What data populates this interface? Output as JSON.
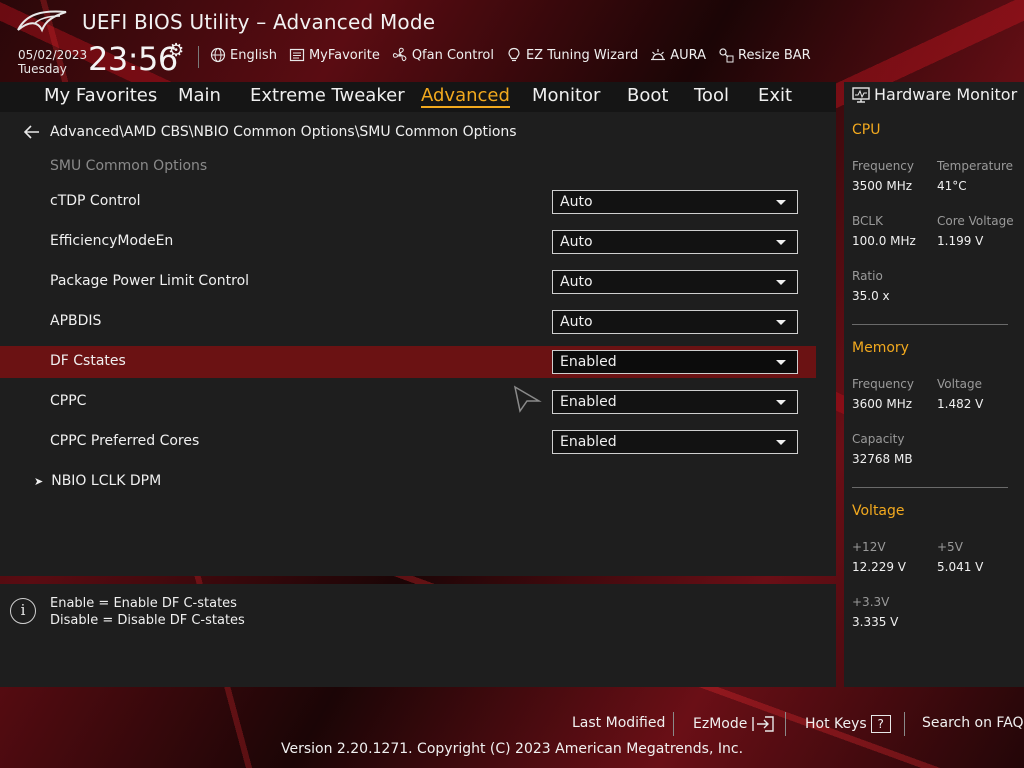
{
  "app": {
    "title": "UEFI BIOS Utility – Advanced Mode"
  },
  "header": {
    "date": "05/02/2023",
    "weekday": "Tuesday",
    "time": "23:56",
    "tools": [
      {
        "label": "English",
        "icon": "globe-icon"
      },
      {
        "label": "MyFavorite",
        "icon": "favorite-list-icon"
      },
      {
        "label": "Qfan Control",
        "icon": "fan-icon"
      },
      {
        "label": "EZ Tuning Wizard",
        "icon": "bulb-icon"
      },
      {
        "label": "AURA",
        "icon": "aura-light-icon"
      },
      {
        "label": "Resize BAR",
        "icon": "resize-bar-icon"
      }
    ]
  },
  "tabs": [
    {
      "label": "My Favorites"
    },
    {
      "label": "Main"
    },
    {
      "label": "Extreme Tweaker"
    },
    {
      "label": "Advanced",
      "active": true
    },
    {
      "label": "Monitor"
    },
    {
      "label": "Boot"
    },
    {
      "label": "Tool"
    },
    {
      "label": "Exit"
    }
  ],
  "breadcrumb": "Advanced\\AMD CBS\\NBIO Common Options\\SMU Common Options",
  "section_label": "SMU Common Options",
  "settings": [
    {
      "label": "cTDP Control",
      "value": "Auto"
    },
    {
      "label": "EfficiencyModeEn",
      "value": "Auto"
    },
    {
      "label": "Package Power Limit Control",
      "value": "Auto"
    },
    {
      "label": "APBDIS",
      "value": "Auto"
    },
    {
      "label": "DF Cstates",
      "value": "Enabled",
      "selected": true
    },
    {
      "label": "CPPC",
      "value": "Enabled"
    },
    {
      "label": "CPPC Preferred Cores",
      "value": "Enabled"
    }
  ],
  "submenu": {
    "label": "NBIO LCLK DPM"
  },
  "help": {
    "line1": "Enable = Enable DF C-states",
    "line2": "Disable = Disable DF C-states"
  },
  "hardware_monitor": {
    "title": "Hardware Monitor",
    "cpu": {
      "heading": "CPU",
      "frequency_label": "Frequency",
      "frequency": "3500 MHz",
      "temperature_label": "Temperature",
      "temperature": "41°C",
      "bclk_label": "BCLK",
      "bclk": "100.0 MHz",
      "core_voltage_label": "Core Voltage",
      "core_voltage": "1.199 V",
      "ratio_label": "Ratio",
      "ratio": "35.0 x"
    },
    "memory": {
      "heading": "Memory",
      "frequency_label": "Frequency",
      "frequency": "3600 MHz",
      "voltage_label": "Voltage",
      "voltage": "1.482 V",
      "capacity_label": "Capacity",
      "capacity": "32768 MB"
    },
    "voltage": {
      "heading": "Voltage",
      "v12_label": "+12V",
      "v12": "12.229 V",
      "v5_label": "+5V",
      "v5": "5.041 V",
      "v33_label": "+3.3V",
      "v33": "3.335 V"
    }
  },
  "footer": {
    "last_modified": "Last Modified",
    "ezmode": "EzMode",
    "hot_keys": "Hot Keys",
    "hot_keys_key": "?",
    "faq": "Search on FAQ",
    "copyright": "Version 2.20.1271. Copyright (C) 2023 American Megatrends, Inc."
  },
  "colors": {
    "accent": "#f2a91e",
    "selection": "#6b1213",
    "panel": "#1e1e1e"
  }
}
